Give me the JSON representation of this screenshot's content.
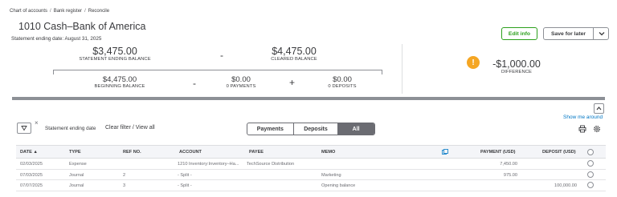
{
  "breadcrumb": {
    "items": [
      "Chart of accounts",
      "Bank register",
      "Reconcile"
    ]
  },
  "header": {
    "title": "1010 Cash–Bank of America",
    "statement_date": "Statement ending date: August 31, 2025",
    "edit_info": "Edit info",
    "save_for_later": "Save for later"
  },
  "summary": {
    "statement_ending_balance": {
      "value": "$3,475.00",
      "label": "STATEMENT ENDING BALANCE"
    },
    "cleared_balance": {
      "value": "$4,475.00",
      "label": "CLEARED BALANCE"
    },
    "beginning_balance": {
      "value": "$4,475.00",
      "label": "BEGINNING BALANCE"
    },
    "payments": {
      "value": "$0.00",
      "label": "0 PAYMENTS"
    },
    "deposits": {
      "value": "$0.00",
      "label": "0 DEPOSITS"
    },
    "difference": {
      "value": "-$1,000.00",
      "label": "DIFFERENCE"
    },
    "op_minus_1": "-",
    "op_minus_2": "-",
    "op_plus": "+"
  },
  "toolbar": {
    "show_me_around": "Show me around",
    "filter_label": "Statement ending date",
    "clear_filter": "Clear filter / View all",
    "filter_close": "×",
    "tabs": [
      "Payments",
      "Deposits",
      "All"
    ],
    "active_tab": "All"
  },
  "table": {
    "headers": {
      "date": "DATE ▲",
      "type": "TYPE",
      "ref": "REF NO.",
      "account": "ACCOUNT",
      "payee": "PAYEE",
      "memo": "MEMO",
      "payment": "PAYMENT (USD)",
      "deposit": "DEPOSIT (USD)"
    },
    "rows": [
      {
        "date": "02/03/2025",
        "type": "Expense",
        "ref": "",
        "account": "1210 Inventory:Inventory–Ha...",
        "payee": "TechSource Distribution",
        "memo": "",
        "payment": "7,450.00",
        "deposit": ""
      },
      {
        "date": "07/03/2025",
        "type": "Journal",
        "ref": "2",
        "account": "- Split -",
        "payee": "",
        "memo": "Marketing",
        "payment": "975.00",
        "deposit": ""
      },
      {
        "date": "07/07/2025",
        "type": "Journal",
        "ref": "3",
        "account": "- Split -",
        "payee": "",
        "memo": "Opening balance",
        "payment": "",
        "deposit": "100,000.00"
      }
    ]
  },
  "colors": {
    "accent_green": "#2ca01c",
    "link_blue": "#0077c5",
    "warning_orange": "#f5a623"
  },
  "icons": {
    "warning": "exclamation-icon",
    "filter": "filter-funnel-icon",
    "print": "print-icon",
    "settings": "gear-icon",
    "collapse": "chevron-up-icon",
    "dropdown": "chevron-down-icon",
    "memo_column": "copy-icon"
  }
}
